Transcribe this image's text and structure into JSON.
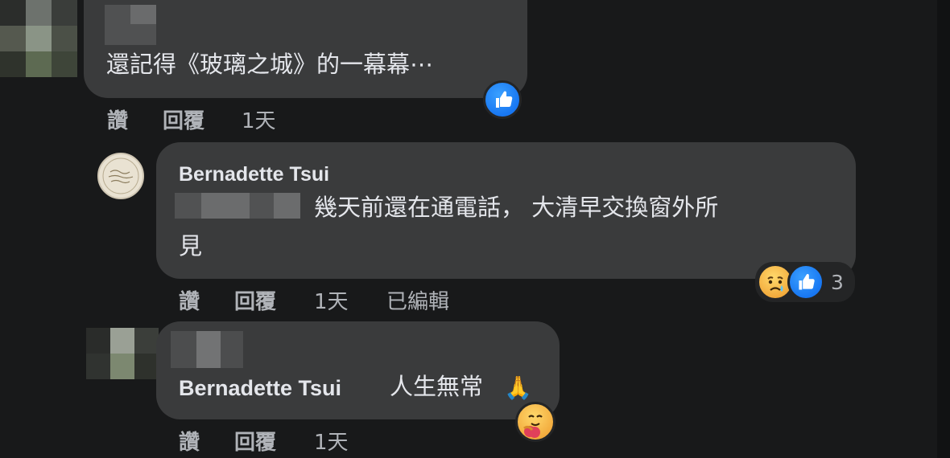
{
  "colors": {
    "background": "#18191a",
    "bubble": "#3a3b3c",
    "text": "#e4e6eb",
    "secondary_text": "#b0b3b8",
    "like_blue": "#1877f2",
    "reaction_yellow": "#f7c64a"
  },
  "comments": [
    {
      "author_hidden": true,
      "text": "還記得《玻璃之城》的一幕幕⋯",
      "actions": {
        "like": "讚",
        "reply": "回覆",
        "time": "1天"
      },
      "reactions": {
        "icons": [
          "like-icon"
        ]
      }
    },
    {
      "author": "Bernadette Tsui",
      "mention_hidden": true,
      "text_line1": "幾天前還在通電話， 大清早交換窗外所",
      "text_line2": "見",
      "actions": {
        "like": "讚",
        "reply": "回覆",
        "time": "1天",
        "edited": "已編輯"
      },
      "reactions": {
        "icons": [
          "sad-face-icon",
          "like-icon"
        ],
        "count": "3"
      }
    },
    {
      "author_hidden": true,
      "mention": "Bernadette Tsui",
      "text": "人生無常",
      "emoji": "🙏",
      "actions": {
        "like": "讚",
        "reply": "回覆",
        "time": "1天"
      },
      "reactions": {
        "icons": [
          "hug-face-icon"
        ]
      }
    }
  ]
}
